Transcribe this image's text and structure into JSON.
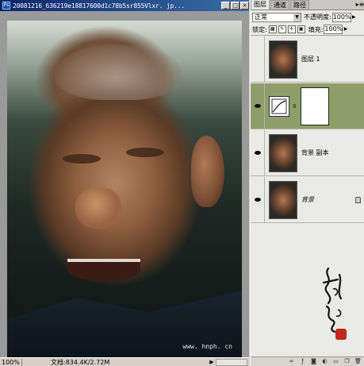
{
  "document": {
    "title": "20081216_636219e18817600d1c78b5sr855Vlxr. jp...",
    "watermark": "www. hnph. cn",
    "status": {
      "zoom": "100%",
      "doc_size": "文档:834.4K/2.72M"
    }
  },
  "layers_panel": {
    "tabs": [
      "图层",
      "通道",
      "路径"
    ],
    "blend_mode": "正常",
    "opacity_label": "不透明度:",
    "opacity_value": "100%",
    "lock_label": "锁定:",
    "fill_label": "填充:",
    "fill_value": "100%",
    "layers": [
      {
        "name": "图层 1",
        "visible": false,
        "icon": "portrait-thumbnail"
      },
      {
        "name": "",
        "visible": true,
        "selected": true,
        "icon": "curves-adjustment-icon"
      },
      {
        "name": "背景 副本",
        "visible": true,
        "icon": "portrait-thumbnail"
      },
      {
        "name": "背景",
        "visible": true,
        "locked": true,
        "icon": "portrait-thumbnail"
      }
    ],
    "footer_icons": [
      "link-icon",
      "fx-icon",
      "mask-icon",
      "adjustment-icon",
      "folder-icon",
      "new-layer-icon",
      "trash-icon"
    ]
  },
  "colors": {
    "selected_layer": "#8e9e6a",
    "panel_bg": "#e9e9e5",
    "seal": "#c0281e"
  }
}
